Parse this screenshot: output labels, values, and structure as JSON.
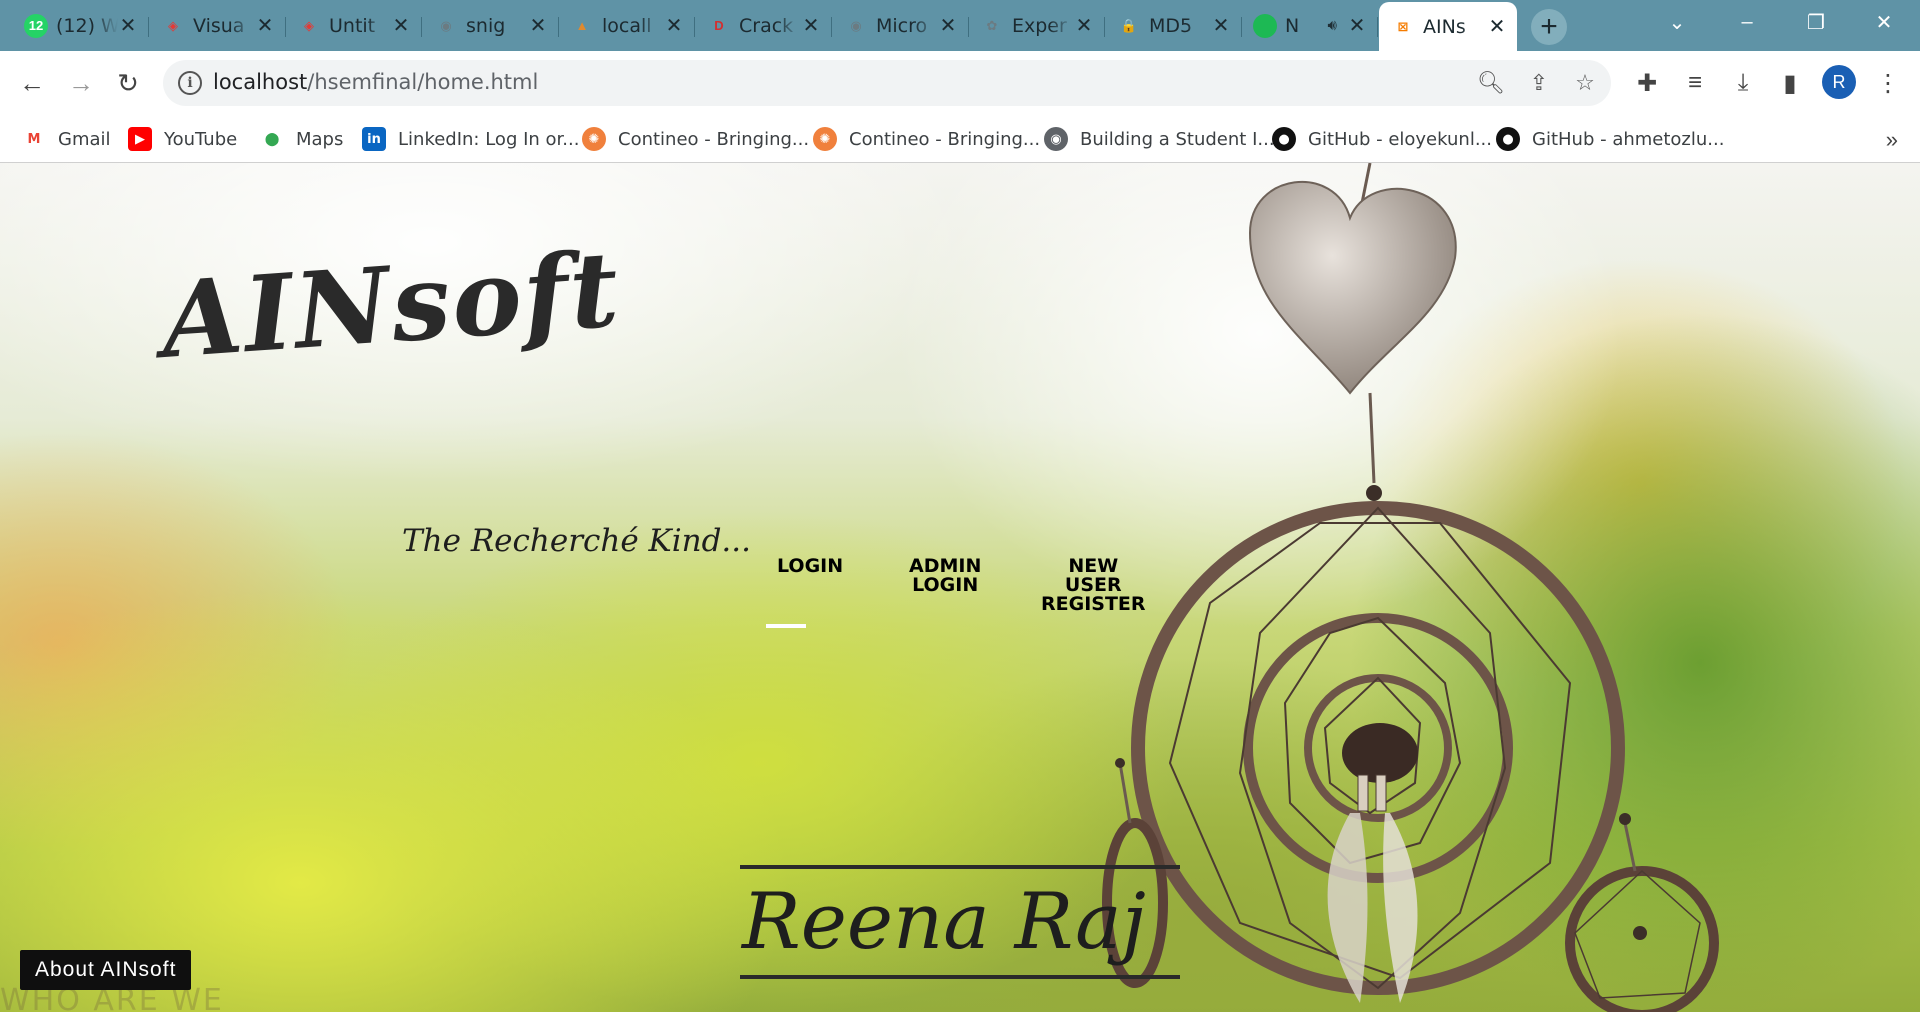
{
  "browser": {
    "tabs": [
      {
        "title": "(12) W",
        "favicon": "whatsapp-icon",
        "favicon_color": "#25d366",
        "favicon_text": "12"
      },
      {
        "title": "Visua",
        "favicon": "diamond-icon",
        "favicon_color": "#e53935",
        "favicon_text": "◈"
      },
      {
        "title": "Untit",
        "favicon": "diamond-icon",
        "favicon_color": "#e53935",
        "favicon_text": "◈"
      },
      {
        "title": "snig",
        "favicon": "globe-icon",
        "favicon_color": "#6b7b82",
        "favicon_text": "◉"
      },
      {
        "title": "locall",
        "favicon": "phpmyadmin-icon",
        "favicon_color": "#e08a2e",
        "favicon_text": "▲"
      },
      {
        "title": "Crack",
        "favicon": "dsa-icon",
        "favicon_color": "#d32f2f",
        "favicon_text": "D"
      },
      {
        "title": "Micro",
        "favicon": "globe-icon",
        "favicon_color": "#6b7b82",
        "favicon_text": "◉"
      },
      {
        "title": "Exper",
        "favicon": "chatgpt-icon",
        "favicon_color": "#6b7b82",
        "favicon_text": "✿"
      },
      {
        "title": "MD5",
        "favicon": "lock-icon",
        "favicon_color": "#111111",
        "favicon_text": "🔒"
      },
      {
        "title": "N",
        "favicon": "spotify-icon",
        "favicon_color": "#1db954",
        "favicon_text": "",
        "audio": true
      },
      {
        "title": "AINs",
        "favicon": "xampp-icon",
        "favicon_color": "#f57c00",
        "favicon_text": "⊠",
        "active": true
      }
    ],
    "new_tab_symbol": "+",
    "url_host": "localhost",
    "url_path": "/hsemfinal/home.html",
    "profile_initial": "R",
    "bookmarks": [
      {
        "label": "Gmail",
        "icon": "gmail-icon",
        "color": "#ea4335",
        "glyph": "M"
      },
      {
        "label": "YouTube",
        "icon": "youtube-icon",
        "color": "#ff0000",
        "glyph": "▶"
      },
      {
        "label": "Maps",
        "icon": "maps-icon",
        "color": "#34a853",
        "glyph": "⬤"
      },
      {
        "label": "LinkedIn: Log In or...",
        "icon": "linkedin-icon",
        "color": "#0a66c2",
        "glyph": "in"
      },
      {
        "label": "Contineo - Bringing...",
        "icon": "contineo-icon",
        "color": "#f0803c",
        "glyph": "✺"
      },
      {
        "label": "Contineo - Bringing...",
        "icon": "contineo-icon",
        "color": "#f0803c",
        "glyph": "✺"
      },
      {
        "label": "Building a Student I...",
        "icon": "globe-icon",
        "color": "#5f6368",
        "glyph": "◉"
      },
      {
        "label": "GitHub - eloyekunl...",
        "icon": "github-icon",
        "color": "#111111",
        "glyph": "●"
      },
      {
        "label": "GitHub - ahmetozlu...",
        "icon": "github-icon",
        "color": "#111111",
        "glyph": "●"
      }
    ]
  },
  "page": {
    "brand": "AINsoft",
    "tagline": "The Recherché Kind...",
    "nav": {
      "login": "LOGIN",
      "admin_login_1": "ADMIN",
      "admin_login_2": "LOGIN",
      "register_1": "NEW",
      "register_2": "USER",
      "register_3": "REGISTER"
    },
    "signature": "Reena Raj",
    "about_button": "About AINsoft",
    "section_hint": "WHO ARE WE"
  }
}
